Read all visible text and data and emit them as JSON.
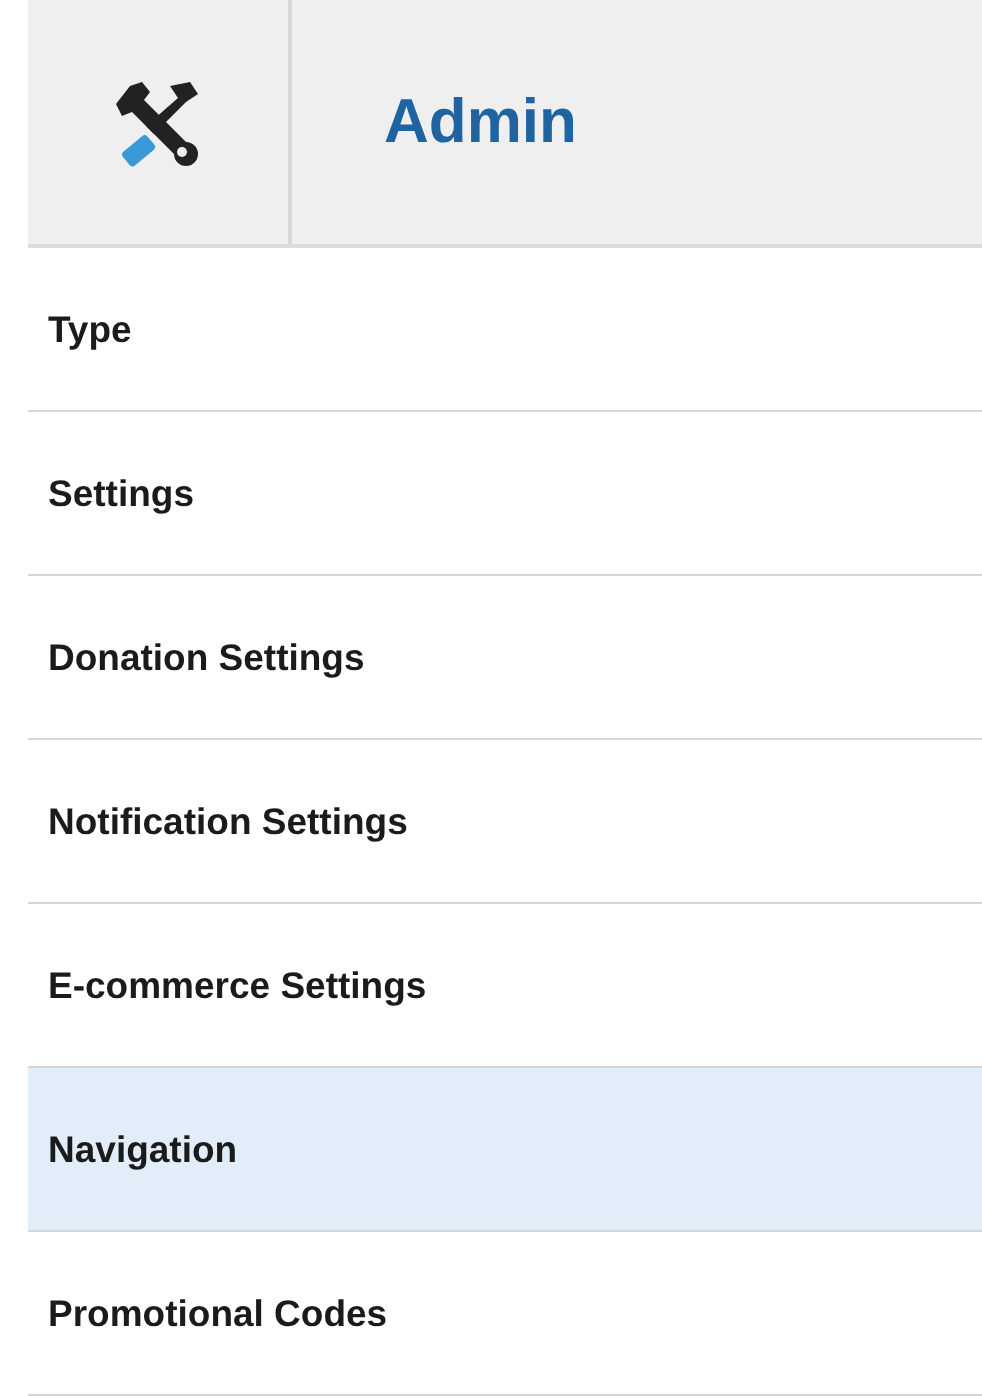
{
  "header": {
    "title": "Admin"
  },
  "menu": [
    {
      "label": "Type",
      "selected": false
    },
    {
      "label": "Settings",
      "selected": false
    },
    {
      "label": "Donation Settings",
      "selected": false
    },
    {
      "label": "Notification Settings",
      "selected": false
    },
    {
      "label": "E-commerce Settings",
      "selected": false
    },
    {
      "label": "Navigation",
      "selected": true
    },
    {
      "label": "Promotional Codes",
      "selected": false
    }
  ]
}
